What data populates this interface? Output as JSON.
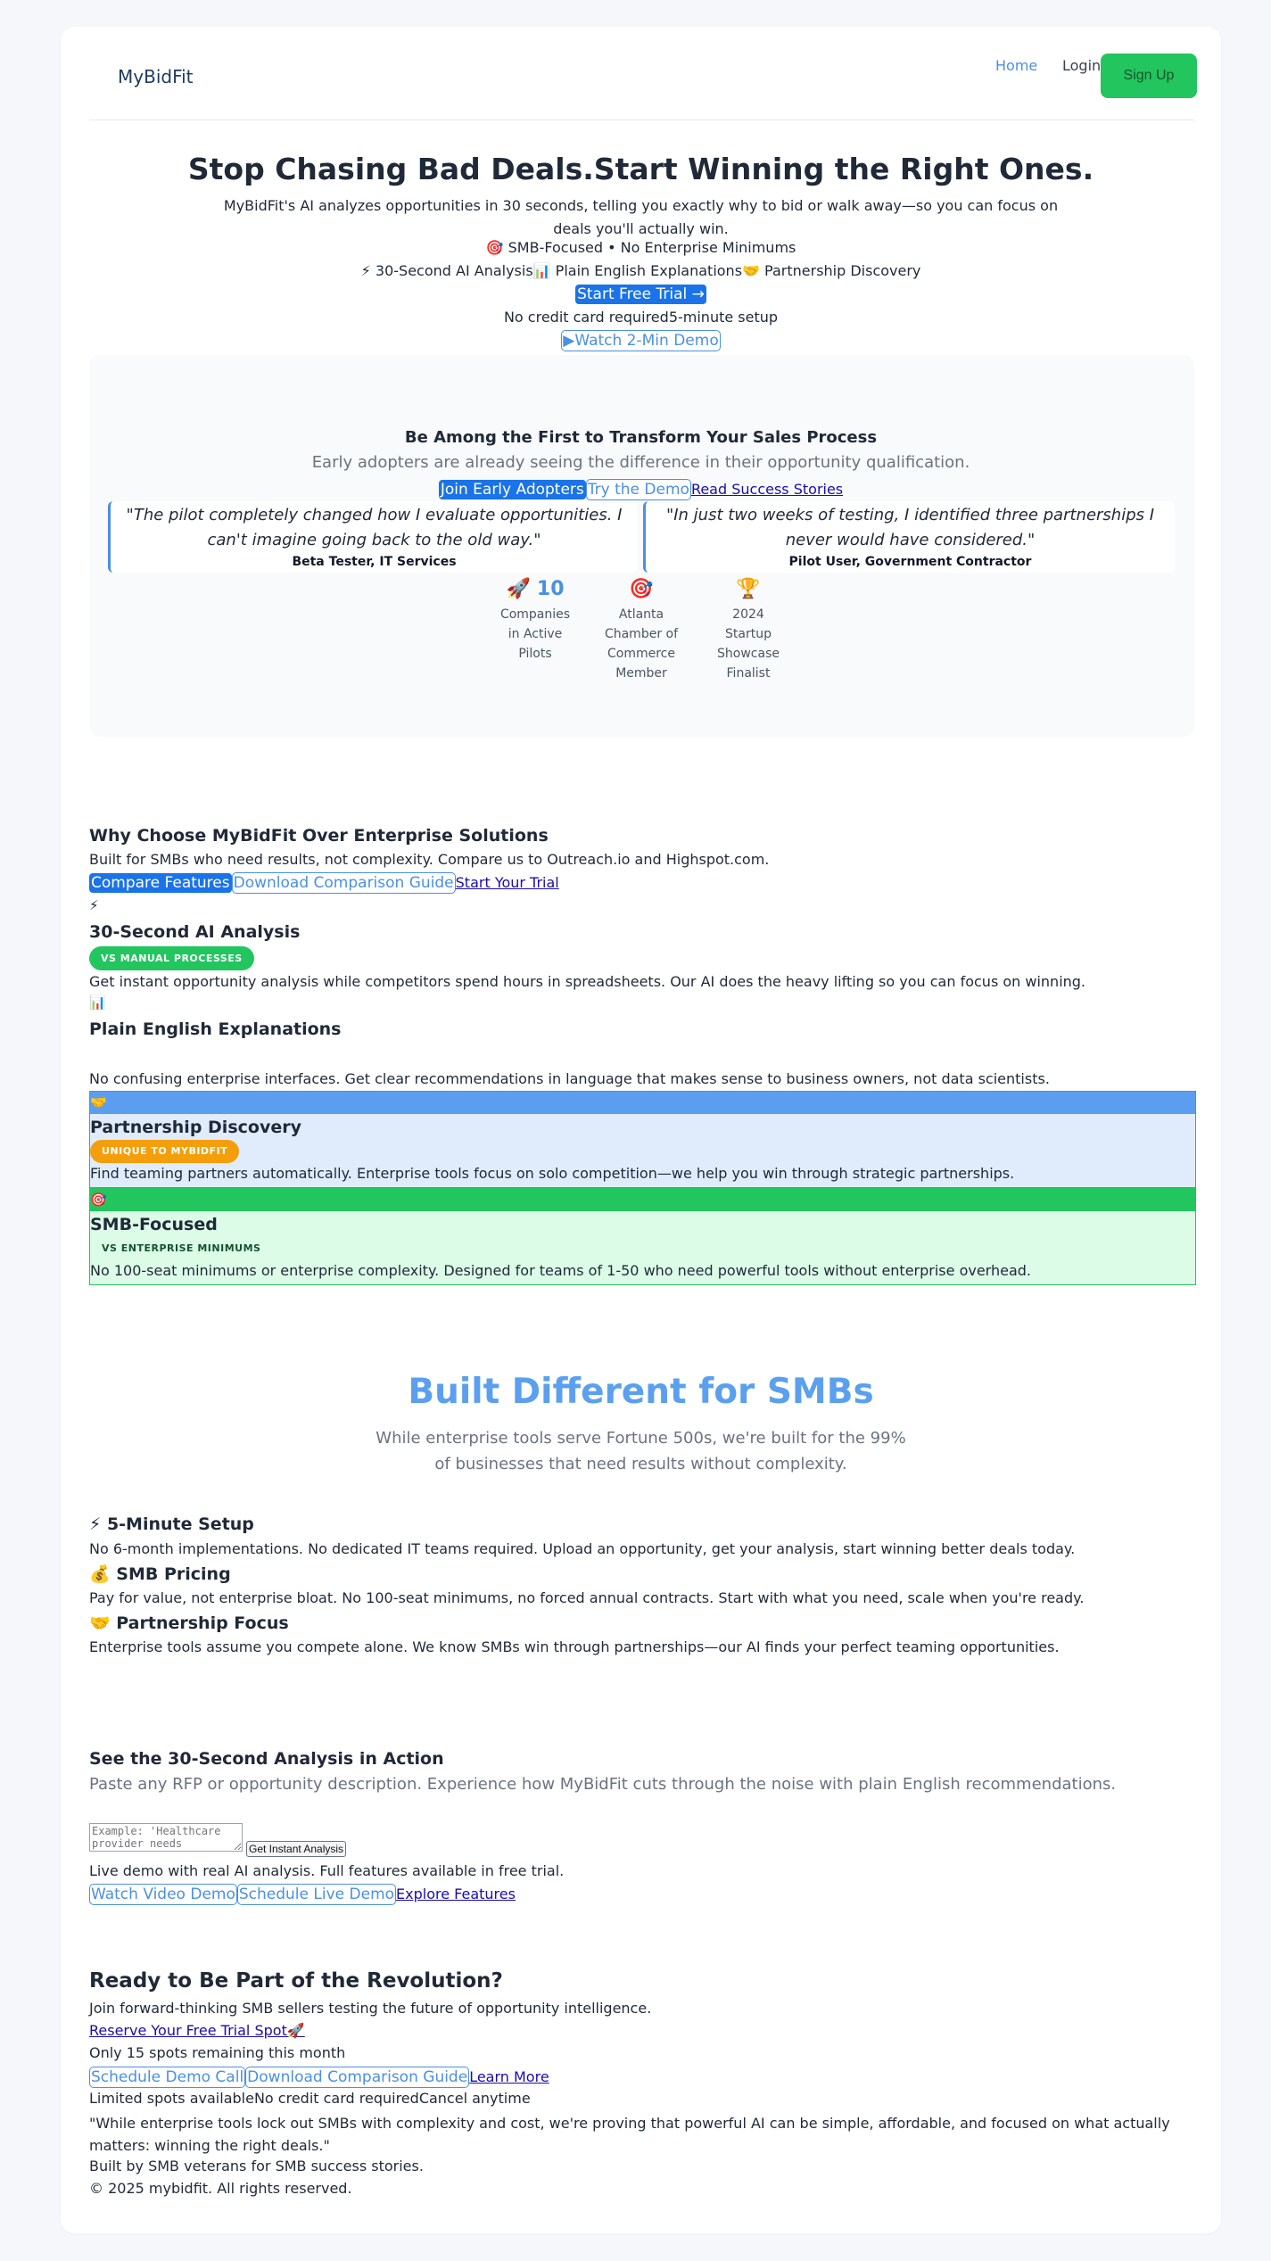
{
  "header": {
    "brand": "MyBidFit",
    "nav": {
      "home": "Home",
      "login": "Login",
      "signup": "Sign Up"
    }
  },
  "hero": {
    "title": "Stop Chasing Bad Deals.Start Winning the Right Ones.",
    "description": "MyBidFit's AI analyzes opportunities in 30 seconds, telling you exactly why to bid or walk away—so you can focus on deals you'll actually win.",
    "tagline": "🎯 SMB-Focused • No Enterprise Minimums",
    "features": [
      "⚡ 30-Second AI Analysis",
      "📊 Plain English Explanations",
      "🤝 Partnership Discovery"
    ],
    "cta_primary": "Start Free Trial →",
    "trust_notes": [
      "No credit card required",
      "5-minute setup"
    ],
    "cta_secondary": "▶Watch 2-Min Demo"
  },
  "early_adopters": {
    "title": "Be Among the First to Transform Your Sales Process",
    "subtitle": "Early adopters are already seeing the difference in their opportunity qualification.",
    "buttons": {
      "join": "Join Early Adopters",
      "demo": "Try the Demo",
      "stories": "Read Success Stories"
    },
    "quotes": [
      {
        "text": "\"The pilot completely changed how I evaluate opportunities. I can't imagine going back to the old way.\"",
        "author": "Beta Tester, IT Services"
      },
      {
        "text": "\"In just two weeks of testing, I identified three partnerships I never would have considered.\"",
        "author": "Pilot User, Government Contractor"
      }
    ],
    "stats": [
      {
        "icon": "🚀",
        "number": "10",
        "label": "Companies in Active Pilots"
      },
      {
        "icon": "🎯",
        "label": "Atlanta Chamber of Commerce Member"
      },
      {
        "icon": "🏆",
        "label": "2024 Startup Showcase Finalist"
      }
    ]
  },
  "why": {
    "title": "Why Choose MyBidFit Over Enterprise Solutions",
    "subtitle": "Built for SMBs who need results, not complexity. Compare us to Outreach.io and Highspot.com.",
    "buttons": {
      "compare": "Compare Features",
      "download": "Download Comparison Guide",
      "trial": "Start Your Trial"
    },
    "features": [
      {
        "icon": "⚡",
        "title": "30-Second AI Analysis",
        "badge": "VS MANUAL PROCESSES",
        "text": "Get instant opportunity analysis while competitors spend hours in spreadsheets. Our AI does the heavy lifting so you can focus on winning."
      },
      {
        "icon": "📊",
        "title": "Plain English Explanations",
        "badge": "",
        "text": "No confusing enterprise interfaces. Get clear recommendations in language that makes sense to business owners, not data scientists."
      },
      {
        "icon": "🤝",
        "title": "Partnership Discovery",
        "badge": "UNIQUE TO MYBIDFIT",
        "text": "Find teaming partners automatically. Enterprise tools focus on solo competition—we help you win through strategic partnerships."
      },
      {
        "icon": "🎯",
        "title": "SMB-Focused",
        "badge": "VS ENTERPRISE MINIMUMS",
        "text": "No 100-seat minimums or enterprise complexity. Designed for teams of 1-50 who need powerful tools without enterprise overhead."
      }
    ]
  },
  "built": {
    "title": "Built Different for SMBs",
    "subtitle": "While enterprise tools serve Fortune 500s, we're built for the 99% of businesses that need results without complexity.",
    "items": [
      {
        "title": "⚡ 5-Minute Setup",
        "text": "No 6-month implementations. No dedicated IT teams required. Upload an opportunity, get your analysis, start winning better deals today."
      },
      {
        "title": "💰 SMB Pricing",
        "text": "Pay for value, not enterprise bloat. No 100-seat minimums, no forced annual contracts. Start with what you need, scale when you're ready."
      },
      {
        "title": "🤝 Partnership Focus",
        "text": "Enterprise tools assume you compete alone. We know SMBs win through partnerships—our AI finds your perfect teaming opportunities."
      }
    ]
  },
  "demo": {
    "title": "See the 30-Second Analysis in Action",
    "subtitle": "Paste any RFP or opportunity description. Experience how MyBidFit cuts through the noise with plain English recommendations.",
    "placeholder": "Example: 'Healthcare provider needs",
    "analyze_button": "Get Instant Analysis",
    "note": "Live demo with real AI analysis. Full features available in free trial.",
    "buttons": {
      "video": "Watch Video Demo",
      "schedule": "Schedule Live Demo",
      "explore": "Explore Features"
    }
  },
  "cta": {
    "title": "Ready to Be Part of the Revolution?",
    "subtitle": "Join forward-thinking SMB sellers testing the future of opportunity intelligence.",
    "reserve": "Reserve Your Free Trial Spot🚀",
    "spots": "Only 15 spots remaining this month",
    "buttons": {
      "schedule": "Schedule Demo Call",
      "download": "Download Comparison Guide",
      "learn": "Learn More"
    },
    "notes": [
      "Limited spots available",
      "No credit card required",
      "Cancel anytime"
    ],
    "quote": "\"While enterprise tools lock out SMBs with complexity and cost, we're proving that powerful AI can be simple, affordable, and focused on what actually matters: winning the right deals.\"",
    "built_by": "Built by SMB veterans for SMB success stories.",
    "copyright": "© 2025 mybidfit. All rights reserved."
  },
  "colors": {
    "accent": "#4a90e2",
    "primary_button": "#1a73e8",
    "success": "#22c55e",
    "orange": "#f59e0b"
  }
}
